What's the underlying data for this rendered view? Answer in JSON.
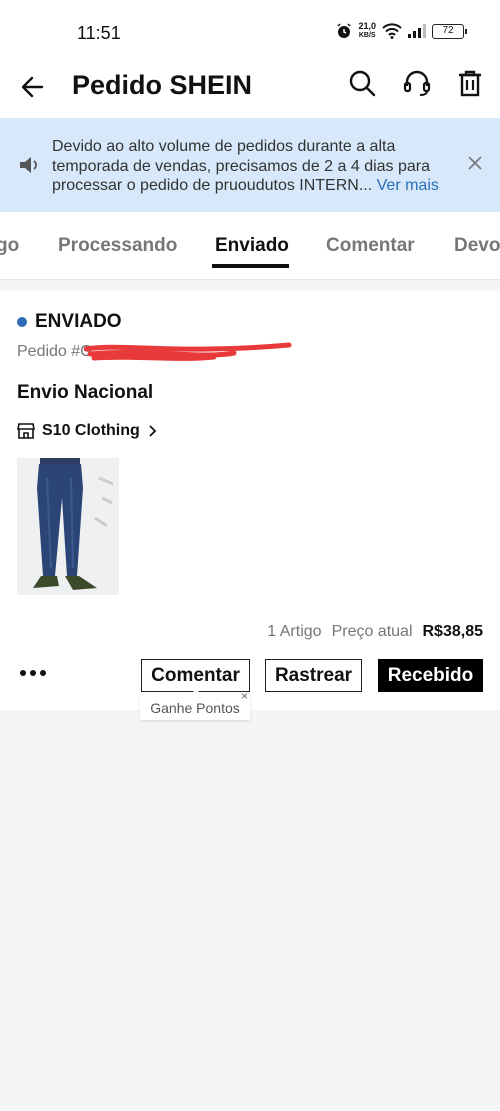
{
  "status_bar": {
    "time": "11:51",
    "speed_value": "21,0",
    "speed_unit": "KB/S",
    "battery": "72"
  },
  "header": {
    "title": "Pedido SHEIN"
  },
  "notice": {
    "text": "Devido ao alto volume de pedidos durante a alta temporada de vendas, precisamos de 2 a 4 dias para processar o pedido de pruoudutos INTERN...",
    "more_label": "Ver mais"
  },
  "tabs": [
    {
      "label": "go"
    },
    {
      "label": "Processando"
    },
    {
      "label": "Enviado",
      "active": true
    },
    {
      "label": "Comentar"
    },
    {
      "label": "Devol"
    }
  ],
  "order": {
    "status": "ENVIADO",
    "status_color": "#2f6bb3",
    "number_prefix": "Pedido #G",
    "shipping_type": "Envio Nacional",
    "store_name": "S10 Clothing",
    "item_count": "1 Artigo",
    "price_label": "Preço atual",
    "price": "R$38,85"
  },
  "actions": {
    "comment_label": "Comentar",
    "track_label": "Rastrear",
    "received_label": "Recebido",
    "tooltip": "Ganhe Pontos",
    "tooltip_close": "×"
  }
}
